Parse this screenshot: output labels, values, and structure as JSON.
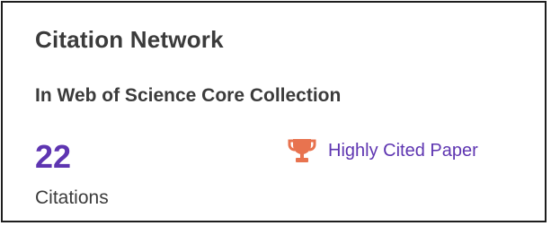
{
  "card": {
    "title": "Citation Network",
    "subtitle": "In Web of Science Core Collection",
    "citations": {
      "count": "22",
      "label": "Citations"
    },
    "badge": {
      "icon": "trophy-icon",
      "label": "Highly Cited Paper"
    }
  },
  "colors": {
    "accent": "#5e35b1",
    "trophy": "#e8734f",
    "text": "#3b3b3b",
    "border": "#1e1e1e"
  }
}
